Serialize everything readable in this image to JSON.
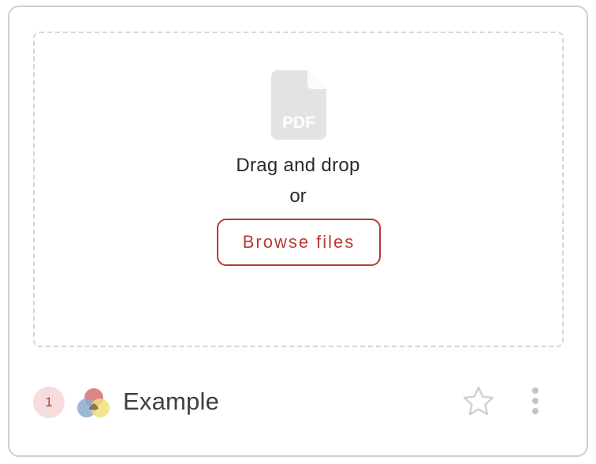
{
  "upload": {
    "file_type_label": "PDF",
    "drag_text": "Drag and drop",
    "or_text": "or",
    "browse_label": "Browse files"
  },
  "footer": {
    "badge_count": "1",
    "title": "Example"
  },
  "icons": {
    "file": "pdf-file-icon",
    "collection": "venn-circles-icon",
    "favorite": "star-outline-icon",
    "menu": "vertical-dots-icon"
  },
  "colors": {
    "accent": "#b93a32",
    "badge_bg": "#f6dcdc",
    "icon_gray": "#e3e3e3",
    "dashed_border": "#d6d6d6",
    "venn_red": "#d9787a",
    "venn_blue": "#8eaad0",
    "venn_yellow": "#f0e07e"
  }
}
